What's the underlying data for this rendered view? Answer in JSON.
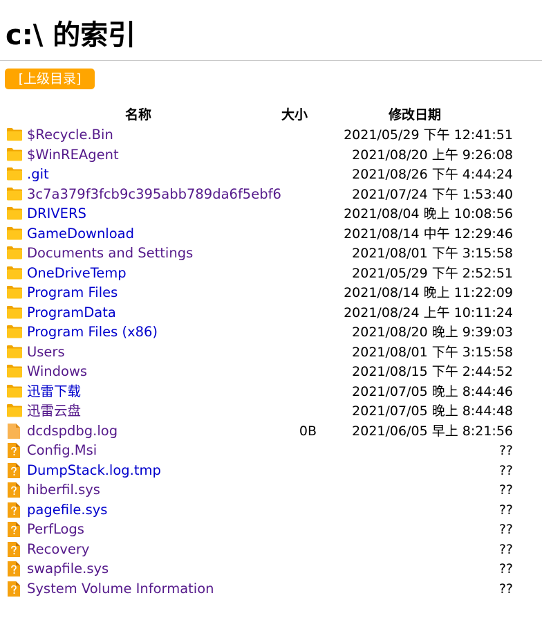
{
  "page": {
    "title": "c:\\ 的索引"
  },
  "toolbar": {
    "parent_label": "[上级目录]"
  },
  "table": {
    "headers": {
      "name": "名称",
      "size": "大小",
      "date": "修改日期"
    },
    "rows": [
      {
        "name": "$Recycle.Bin",
        "size": "",
        "date": "2021/05/29 下午 12:41:51",
        "type": "folder",
        "color": "purple"
      },
      {
        "name": "$WinREAgent",
        "size": "",
        "date": "2021/08/20 上午 9:26:08",
        "type": "folder",
        "color": "purple"
      },
      {
        "name": ".git",
        "size": "",
        "date": "2021/08/26 下午 4:44:24",
        "type": "folder",
        "color": "blue"
      },
      {
        "name": "3c7a379f3fcb9c395abb789da6f5ebf6",
        "size": "",
        "date": "2021/07/24 下午 1:53:40",
        "type": "folder",
        "color": "purple"
      },
      {
        "name": "DRIVERS",
        "size": "",
        "date": "2021/08/04 晚上 10:08:56",
        "type": "folder",
        "color": "blue"
      },
      {
        "name": "GameDownload",
        "size": "",
        "date": "2021/08/14 中午 12:29:46",
        "type": "folder",
        "color": "blue"
      },
      {
        "name": "Documents and Settings",
        "size": "",
        "date": "2021/08/01 下午 3:15:58",
        "type": "folder",
        "color": "purple"
      },
      {
        "name": "OneDriveTemp",
        "size": "",
        "date": "2021/05/29 下午 2:52:51",
        "type": "folder",
        "color": "blue"
      },
      {
        "name": "Program Files",
        "size": "",
        "date": "2021/08/14 晚上 11:22:09",
        "type": "folder",
        "color": "blue"
      },
      {
        "name": "ProgramData",
        "size": "",
        "date": "2021/08/24 上午 10:11:24",
        "type": "folder",
        "color": "blue"
      },
      {
        "name": "Program Files (x86)",
        "size": "",
        "date": "2021/08/20 晚上 9:39:03",
        "type": "folder",
        "color": "blue"
      },
      {
        "name": "Users",
        "size": "",
        "date": "2021/08/01 下午 3:15:58",
        "type": "folder",
        "color": "purple"
      },
      {
        "name": "Windows",
        "size": "",
        "date": "2021/08/15 下午 2:44:52",
        "type": "folder",
        "color": "purple"
      },
      {
        "name": "迅雷下载",
        "size": "",
        "date": "2021/07/05 晚上 8:44:46",
        "type": "folder",
        "color": "blue"
      },
      {
        "name": "迅雷云盘",
        "size": "",
        "date": "2021/07/05 晚上 8:44:48",
        "type": "folder",
        "color": "purple"
      },
      {
        "name": "dcdspdbg.log",
        "size": "0B",
        "date": "2021/06/05 早上 8:21:56",
        "type": "file",
        "color": "purple"
      },
      {
        "name": "Config.Msi",
        "size": "",
        "date": "??",
        "type": "unknown",
        "color": "purple"
      },
      {
        "name": "DumpStack.log.tmp",
        "size": "",
        "date": "??",
        "type": "unknown",
        "color": "blue"
      },
      {
        "name": "hiberfil.sys",
        "size": "",
        "date": "??",
        "type": "unknown",
        "color": "purple"
      },
      {
        "name": "pagefile.sys",
        "size": "",
        "date": "??",
        "type": "unknown",
        "color": "blue"
      },
      {
        "name": "PerfLogs",
        "size": "",
        "date": "??",
        "type": "unknown",
        "color": "purple"
      },
      {
        "name": "Recovery",
        "size": "",
        "date": "??",
        "type": "unknown",
        "color": "purple"
      },
      {
        "name": "swapfile.sys",
        "size": "",
        "date": "??",
        "type": "unknown",
        "color": "purple"
      },
      {
        "name": "System Volume Information",
        "size": "",
        "date": "??",
        "type": "unknown",
        "color": "purple"
      }
    ]
  },
  "icons": {
    "folder": "folder-icon",
    "file": "file-icon",
    "unknown": "unknown-file-icon"
  },
  "colors": {
    "accent": "#ffa500",
    "link": "#0000cc",
    "visited": "#551a8b",
    "folder": "#ffc41c"
  }
}
